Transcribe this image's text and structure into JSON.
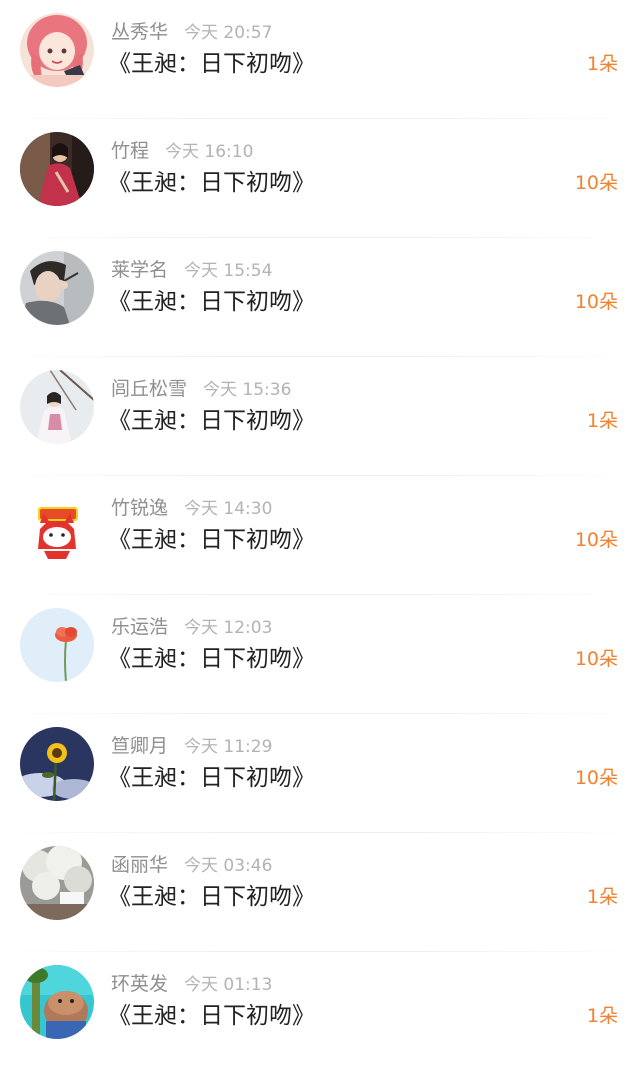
{
  "items": [
    {
      "name": "丛秀华",
      "time": "今天 20:57",
      "title": "《王昶：日下初吻》",
      "amount": "1朵",
      "avatar_icon": "anime-girl-avatar-icon"
    },
    {
      "name": "竹程",
      "time": "今天 16:10",
      "title": "《王昶：日下初吻》",
      "amount": "10朵",
      "avatar_icon": "woman-red-dress-avatar-icon"
    },
    {
      "name": "莱学名",
      "time": "今天 15:54",
      "title": "《王昶：日下初吻》",
      "amount": "10朵",
      "avatar_icon": "young-man-avatar-icon"
    },
    {
      "name": "闾丘松雪",
      "time": "今天 15:36",
      "title": "《王昶：日下初吻》",
      "amount": "1朵",
      "avatar_icon": "girl-in-snow-avatar-icon"
    },
    {
      "name": "竹锐逸",
      "time": "今天 14:30",
      "title": "《王昶：日下初吻》",
      "amount": "10朵",
      "avatar_icon": "cartoon-fox-avatar-icon"
    },
    {
      "name": "乐运浩",
      "time": "今天 12:03",
      "title": "《王昶：日下初吻》",
      "amount": "10朵",
      "avatar_icon": "red-poppy-avatar-icon"
    },
    {
      "name": "笪卿月",
      "time": "今天 11:29",
      "title": "《王昶：日下初吻》",
      "amount": "10朵",
      "avatar_icon": "sunflower-sky-avatar-icon"
    },
    {
      "name": "函丽华",
      "time": "今天 03:46",
      "title": "《王昶：日下初吻》",
      "amount": "1朵",
      "avatar_icon": "blossom-tree-avatar-icon"
    },
    {
      "name": "环英发",
      "time": "今天 01:13",
      "title": "《王昶：日下初吻》",
      "amount": "1朵",
      "avatar_icon": "cartoon-bear-avatar-icon"
    }
  ]
}
